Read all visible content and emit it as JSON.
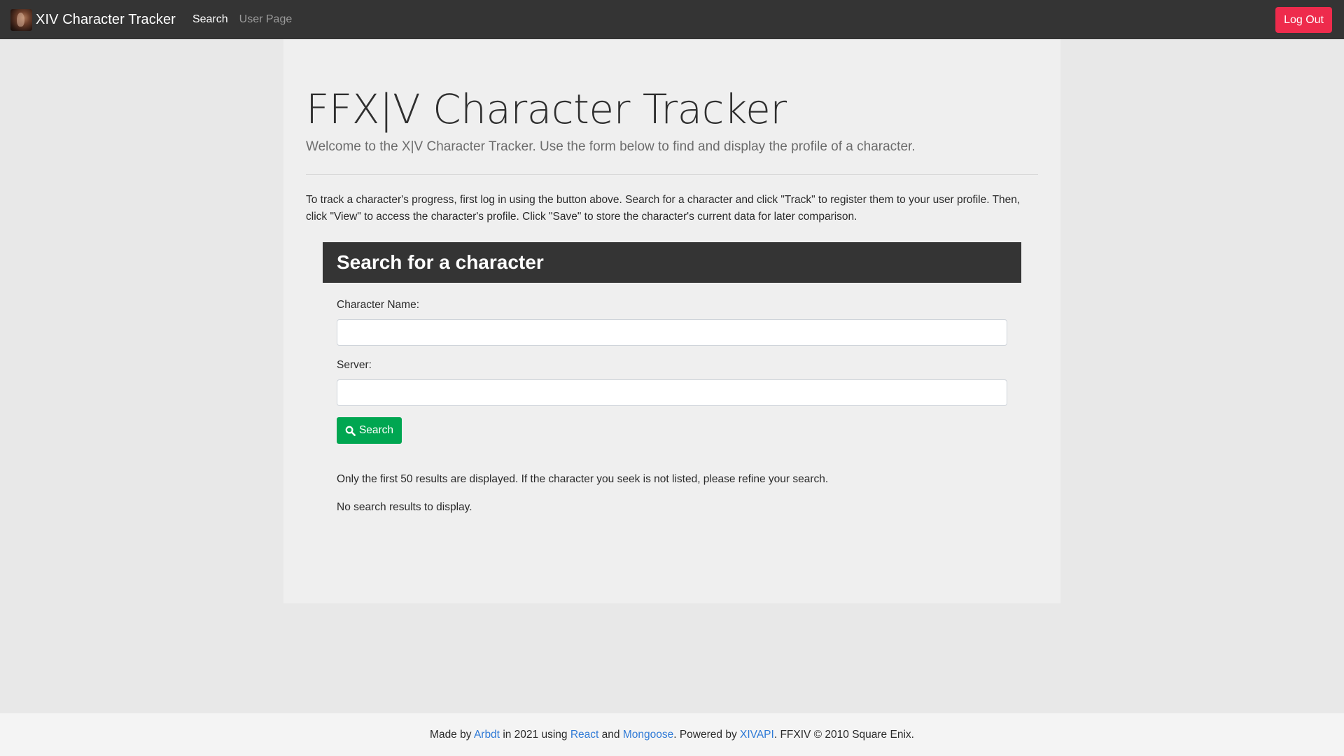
{
  "navbar": {
    "brand": "XIV Character Tracker",
    "links": [
      "Search",
      "User Page"
    ],
    "logout_label": "Log Out"
  },
  "main": {
    "title": "FFX|V Character Tracker",
    "lead": "Welcome to the X|V Character Tracker. Use the form below to find and display the profile of a character.",
    "intro_line1": "To track a character's progress, first log in using the button above. Search for a character and click \"Track\" to register them to your user profile. Then,",
    "intro_line2": "click \"View\" to access the character's profile. Click \"Save\" to store the character's current data for later comparison."
  },
  "search_form": {
    "header": "Search for a character",
    "name_label": "Character Name:",
    "name_value": "",
    "server_label": "Server:",
    "server_value": "",
    "button_label": "Search",
    "button_icon": "search-icon",
    "results_note": "Only the first 50 results are displayed. If the character you seek is not listed, please refine your search.",
    "no_results": "No search results to display."
  },
  "footer": {
    "made_by": "Made by",
    "author": "Arbdt",
    "in_year": "in 2021 using",
    "react": "React",
    "and": "and",
    "mongoose": "Mongoose",
    "powered_by": ". Powered by",
    "xivapi": "XIVAPI",
    "copyright": ". FFXIV © 2010 Square Enix."
  },
  "colors": {
    "navbar_bg": "#343434",
    "logout_bg": "#ee2b4c",
    "search_button_bg": "#00a651",
    "link": "#2f7ad6"
  }
}
